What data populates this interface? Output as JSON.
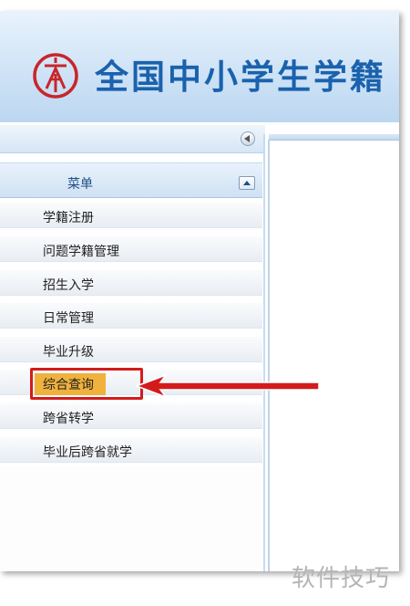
{
  "app": {
    "title": "全国中小学生学籍"
  },
  "sidebar": {
    "collapse_icon": "left-arrow-circle-icon",
    "menu_title": "菜单",
    "toggle_icon": "up-triangle-icon",
    "items": [
      {
        "label": "学籍注册"
      },
      {
        "label": "问题学籍管理"
      },
      {
        "label": "招生入学"
      },
      {
        "label": "日常管理"
      },
      {
        "label": "毕业升级"
      },
      {
        "label": "综合查询",
        "highlighted": true
      },
      {
        "label": "跨省转学"
      },
      {
        "label": "毕业后跨省就学"
      }
    ]
  },
  "annotation": {
    "color": "#d31b1b",
    "highlight_color": "#f0b23c"
  },
  "colors": {
    "brand": "#1a62ad",
    "logo": "#c8262b"
  },
  "watermark": "软件技巧"
}
